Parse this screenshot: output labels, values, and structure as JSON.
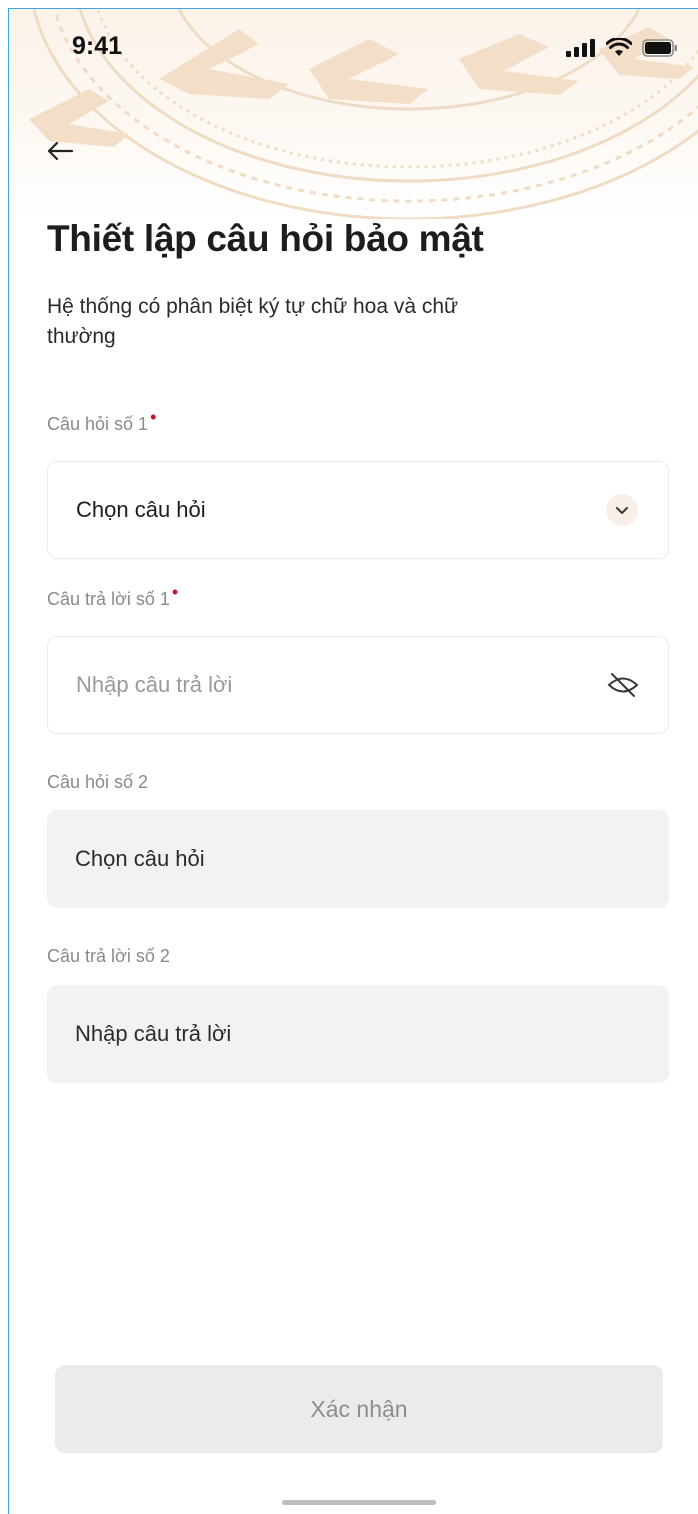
{
  "status_bar": {
    "time": "9:41",
    "signal_icon": "signal-bars-icon",
    "wifi_icon": "wifi-icon",
    "battery_icon": "battery-icon"
  },
  "header": {
    "back_icon": "arrow-left-icon"
  },
  "page": {
    "title": "Thiết lập câu hỏi bảo mật",
    "subtitle": "Hệ thống có phân biệt ký tự chữ hoa và chữ thường"
  },
  "form": {
    "question1": {
      "label": "Câu hỏi số 1",
      "required": "•",
      "value": "Chọn câu hỏi",
      "icon": "chevron-down-icon"
    },
    "answer1": {
      "label": "Câu trả lời số 1",
      "required": "•",
      "placeholder": "Nhập câu trả lời",
      "icon": "eye-off-icon"
    },
    "question2": {
      "label": "Câu hỏi số 2",
      "value": "Chọn câu hỏi"
    },
    "answer2": {
      "label": "Câu trả lời số 2",
      "value": "Nhập câu trả lời"
    }
  },
  "actions": {
    "confirm_label": "Xác nhận"
  },
  "colors": {
    "required": "#c8102e",
    "accent_bg": "#f9efe9",
    "disabled_bg": "#f2f2f2",
    "header_tint": "#f5e3cf"
  }
}
